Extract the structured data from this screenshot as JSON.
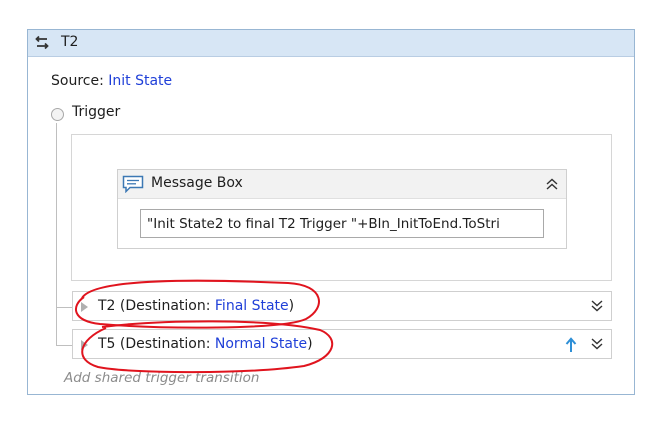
{
  "transition": {
    "title": "T2",
    "source_label": "Source: ",
    "source_value": "Init State",
    "trigger_label": "Trigger",
    "message_box": {
      "title": "Message Box",
      "expression": "\"Init State2 to final T2 Trigger \"+Bln_InitToEnd.ToStri"
    },
    "transitions": [
      {
        "name": "T2",
        "destination_prefix": " (Destination: ",
        "destination": "Final State",
        "suffix": ")"
      },
      {
        "name": "T5",
        "destination_prefix": " (Destination: ",
        "destination": "Normal State",
        "suffix": ")"
      }
    ],
    "add_shared_label": "Add shared trigger transition"
  },
  "colors": {
    "header_bg": "#d7e6f5",
    "link": "#1f3fd8",
    "annotation": "#e0141e"
  },
  "icons": [
    "transition-icon",
    "message-box-icon",
    "collapse-up-icon",
    "expand-down-icon",
    "move-up-arrow-icon"
  ]
}
